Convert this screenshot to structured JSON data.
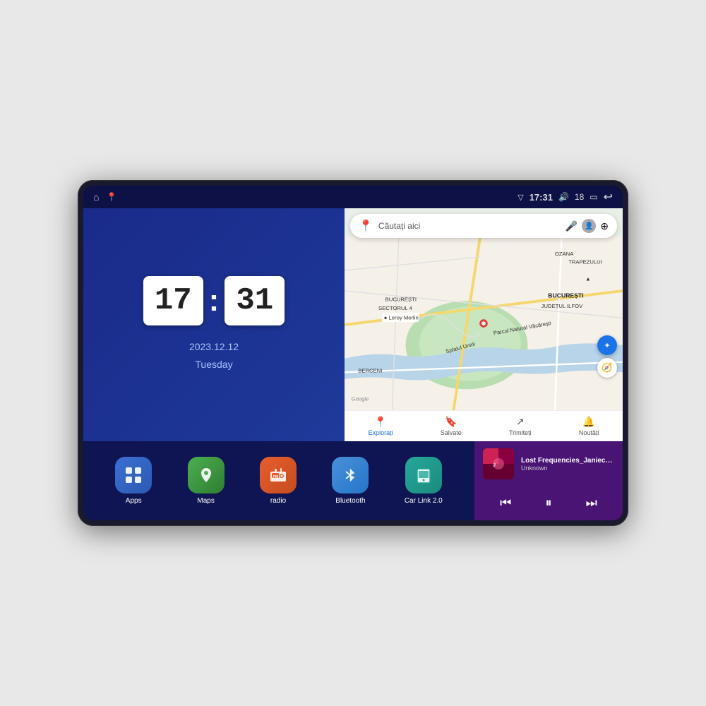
{
  "device": {
    "status_bar": {
      "left_icons": [
        "home",
        "maps-pin"
      ],
      "time": "17:31",
      "signal_icon": "▽",
      "volume_icon": "🔊",
      "volume_level": "18",
      "battery_icon": "▭",
      "back_icon": "↩"
    },
    "clock": {
      "hour": "17",
      "minute": "31",
      "date": "2023.12.12",
      "day": "Tuesday"
    },
    "map": {
      "search_placeholder": "Căutați aici",
      "bottom_tabs": [
        {
          "label": "Explorați",
          "icon": "📍",
          "active": true
        },
        {
          "label": "Salvate",
          "icon": "🔖",
          "active": false
        },
        {
          "label": "Trimiteți",
          "icon": "↗",
          "active": false
        },
        {
          "label": "Noutăți",
          "icon": "🔔",
          "active": false
        }
      ]
    },
    "apps": [
      {
        "id": "apps",
        "label": "Apps",
        "icon_class": "icon-apps",
        "icon": "⊞"
      },
      {
        "id": "maps",
        "label": "Maps",
        "icon_class": "icon-maps",
        "icon": "📍"
      },
      {
        "id": "radio",
        "label": "radio",
        "icon_class": "icon-radio",
        "icon": "📻"
      },
      {
        "id": "bluetooth",
        "label": "Bluetooth",
        "icon_class": "icon-bluetooth",
        "icon": "⚡"
      },
      {
        "id": "carlink",
        "label": "Car Link 2.0",
        "icon_class": "icon-carlink",
        "icon": "📱"
      }
    ],
    "music": {
      "title": "Lost Frequencies_Janieck Devy-...",
      "artist": "Unknown",
      "prev_icon": "⏮",
      "play_icon": "⏸",
      "next_icon": "⏭"
    }
  }
}
